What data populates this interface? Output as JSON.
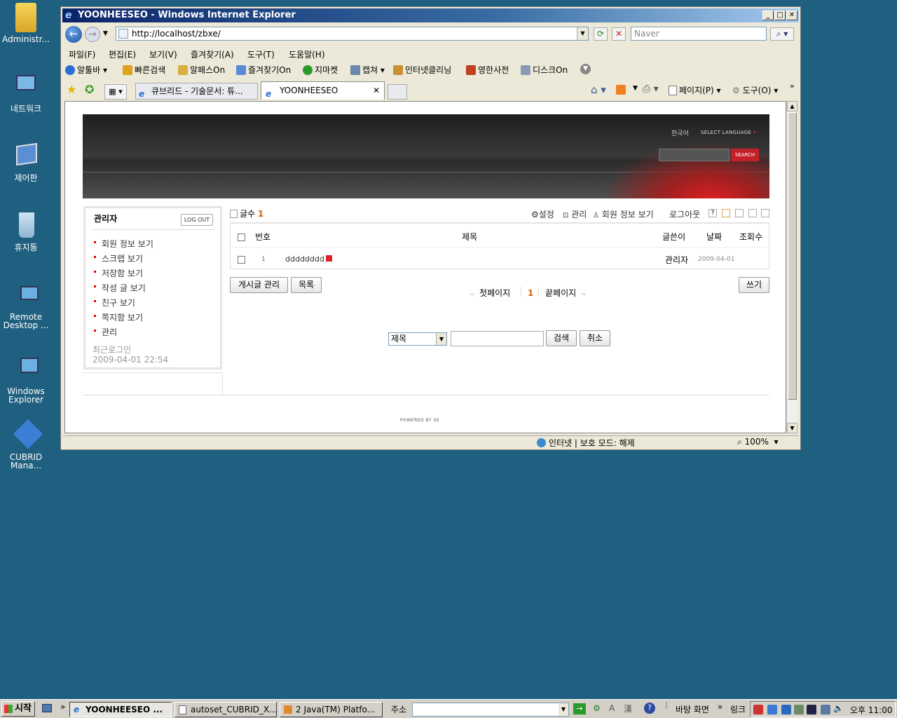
{
  "desktop": {
    "icons": [
      "Administr...",
      "네트워크",
      "제어판",
      "휴지통",
      "Remote Desktop ...",
      "Windows Explorer",
      "CUBRID Mana..."
    ]
  },
  "window": {
    "title": "YOONHEESEO - Windows Internet Explorer",
    "address": "http://localhost/zbxe/",
    "search_placeholder": "Naver"
  },
  "menubar": [
    "파일(F)",
    "편집(E)",
    "보기(V)",
    "즐겨찾기(A)",
    "도구(T)",
    "도움말(H)"
  ],
  "toolbar": [
    "알툴바",
    "빠른검색",
    "알패스On",
    "즐겨찾기On",
    "지마켓",
    "캡쳐",
    "인터넷클리닝",
    "영한사전",
    "디스크On"
  ],
  "tabs": [
    "큐브리드 - 기술문서: 튜...",
    "YOONHEESEO"
  ],
  "command_bar": {
    "page": "페이지(P)",
    "tools": "도구(O)"
  },
  "site": {
    "lang_current": "한국어",
    "lang_select": "SELECT LANGUAGE",
    "search_button": "SEARCH",
    "login": {
      "user": "관리자",
      "logout": "LOG OUT",
      "links": [
        "회원 정보 보기",
        "스크랩 보기",
        "저장함 보기",
        "작성 글 보기",
        "친구 보기",
        "쪽지함 보기",
        "관리"
      ],
      "last_login_label": "최근로그인",
      "last_login_value": "2009-04-01 22:54"
    },
    "board": {
      "count_label": "글수",
      "count_value": "1",
      "actions": [
        "설정",
        "관리",
        "회원 정보 보기",
        "로그아웃"
      ],
      "columns": [
        "번호",
        "제목",
        "글쓴이",
        "날짜",
        "조회수"
      ],
      "rows": [
        {
          "no": "1",
          "title": "dddddddd",
          "author": "관리자",
          "date": "2009-04-01",
          "views": ""
        }
      ],
      "manage_button": "게시글 관리",
      "list_button": "목록",
      "write_button": "쓰기",
      "first_page": "첫페이지",
      "current_page": "1",
      "last_page": "끝페이지",
      "search_field": "제목",
      "search_button": "검색",
      "cancel_button": "취소"
    },
    "footer": "POWERED BY XE"
  },
  "statusbar": {
    "zone": "인터넷 | 보호 모드: 해제",
    "zoom": "100%"
  },
  "taskbar": {
    "start": "시작",
    "tasks": [
      "YOONHEESEO ...",
      "autoset_CUBRID_X...",
      "2 Java(TM) Platfo..."
    ],
    "address_label": "주소",
    "desktop_label": "바탕 화면",
    "links_label": "링크",
    "clock": "오후 11:00"
  }
}
